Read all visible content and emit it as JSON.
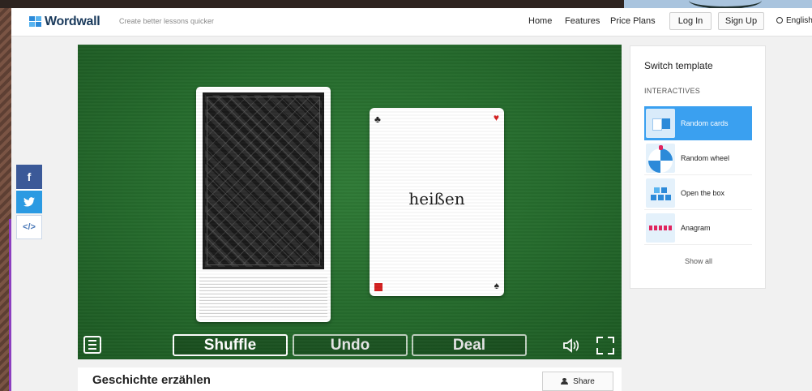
{
  "header": {
    "logo_text": "Wordwall",
    "tagline": "Create better lessons quicker",
    "nav": [
      "Home",
      "Features",
      "Price Plans"
    ],
    "login_label": "Log In",
    "signup_label": "Sign Up",
    "language": "English"
  },
  "social": {
    "facebook": "f",
    "twitter": "t",
    "embed": "</>"
  },
  "game": {
    "card_word": "heißen",
    "suits": {
      "top_left": "♣",
      "top_right": "♥",
      "bottom_left": "♦",
      "bottom_right": "♠"
    },
    "controls": {
      "shuffle": "Shuffle",
      "undo": "Undo",
      "deal": "Deal",
      "sound_icon": "speaker-icon",
      "fullscreen_icon": "fullscreen-icon",
      "menu_icon": "menu-icon"
    }
  },
  "panel": {
    "title": "Switch template",
    "section": "INTERACTIVES",
    "templates": [
      {
        "label": "Random cards",
        "active": true
      },
      {
        "label": "Random wheel",
        "active": false
      },
      {
        "label": "Open the box",
        "active": false
      },
      {
        "label": "Anagram",
        "active": false
      }
    ],
    "show_all": "Show all"
  },
  "activity": {
    "title": "Geschichte erzählen",
    "share_label": "Share"
  },
  "colors": {
    "felt_green": "#256a2c",
    "accent_blue": "#3aa0f0",
    "facebook": "#3b5998",
    "twitter": "#2b9ae2",
    "suit_red": "#d42020"
  }
}
